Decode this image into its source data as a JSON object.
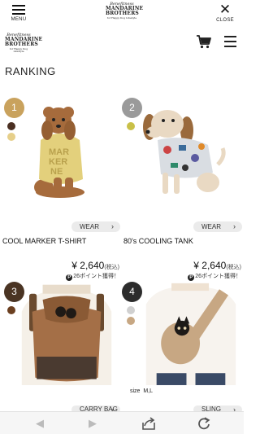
{
  "header": {
    "menu_label": "MENU",
    "close_label": "CLOSE",
    "logo_script": "Benefitness",
    "logo_line1": "MANDARINE",
    "logo_line2": "BROTHERS",
    "logo_tagline": "for Happy Dog Lifestyle"
  },
  "page_title": "RANKING",
  "products": [
    {
      "rank": "1",
      "badge_color": "#c9a25d",
      "swatches": [
        "#4a2f22",
        "#e6cf8a"
      ],
      "category": "WEAR",
      "name": "COOL MARKER T-SHIRT",
      "price": "¥ 2,640",
      "tax_note": "(税込)",
      "points": "26ポイント獲得！",
      "image": "toy-poodle-in-yellow-tshirt",
      "shirt_text": [
        "MAR",
        "KER",
        "NE"
      ]
    },
    {
      "rank": "2",
      "badge_color": "#9a9a9a",
      "swatches": [
        "#c9c048"
      ],
      "category": "WEAR",
      "name": "80's COOLING TANK",
      "price": "¥ 2,640",
      "tax_note": "(税込)",
      "points": "26ポイント獲得！",
      "image": "dachshund-in-printed-tank"
    },
    {
      "rank": "3",
      "badge_color": "#4a3423",
      "swatches": [
        "#6b3f20"
      ],
      "category": "CARRY BAG",
      "image": "brown-backpack-carrier"
    },
    {
      "rank": "4",
      "badge_color": "#2c2c2c",
      "swatches": [
        "#d0d0d0",
        "#c7a783"
      ],
      "category": "SLING",
      "size_label": "size",
      "size_value": "M,L",
      "image": "beige-sling-carrier"
    }
  ],
  "browser_bar": {
    "icons": [
      "back-arrow-icon",
      "forward-arrow-icon",
      "share-icon",
      "reload-icon"
    ]
  }
}
